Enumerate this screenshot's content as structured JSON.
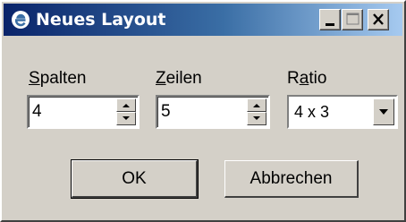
{
  "window": {
    "title": "Neues Layout",
    "icon": "ie-e-icon",
    "controls": [
      "minimize",
      "maximize",
      "close"
    ]
  },
  "fields": {
    "spalten": {
      "label_prefix": "S",
      "label_rest": "palten",
      "value": "4"
    },
    "zeilen": {
      "label_prefix": "Z",
      "label_rest": "eilen",
      "value": "5"
    },
    "ratio": {
      "label_prefix": "R",
      "label_underlined": "a",
      "label_rest": "tio",
      "value": "4 x 3"
    }
  },
  "buttons": {
    "ok": "OK",
    "cancel": "Abbrechen"
  },
  "colors": {
    "title_start": "#0a246a",
    "title_end": "#a6caf0",
    "face": "#d4d0c8"
  }
}
